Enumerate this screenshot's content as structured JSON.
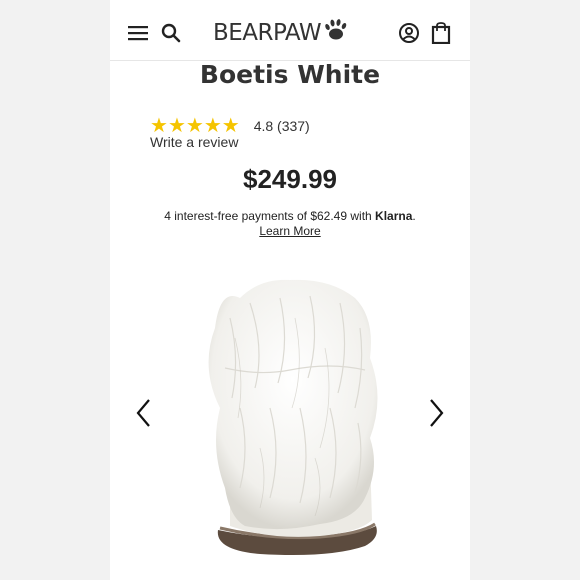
{
  "header": {
    "menu_icon": "hamburger-menu-icon",
    "search_icon": "search-icon",
    "logo_text": "BEARPAW",
    "account_icon": "account-icon",
    "cart_icon": "shopping-bag-icon"
  },
  "product": {
    "title": "Boetis White",
    "rating": 4.8,
    "rating_text": "4.8 (337)",
    "review_link": "Write a review",
    "price": "$249.99",
    "klarna_text": "4 interest-free payments of $62.49 with",
    "klarna_brand": "Klarna",
    "klarna_end": ".",
    "learn_more": "Learn More"
  },
  "gallery": {
    "prev_icon": "chevron-left-icon",
    "next_icon": "chevron-right-icon"
  },
  "colors": {
    "star": "#f5c400",
    "text": "#222222"
  }
}
